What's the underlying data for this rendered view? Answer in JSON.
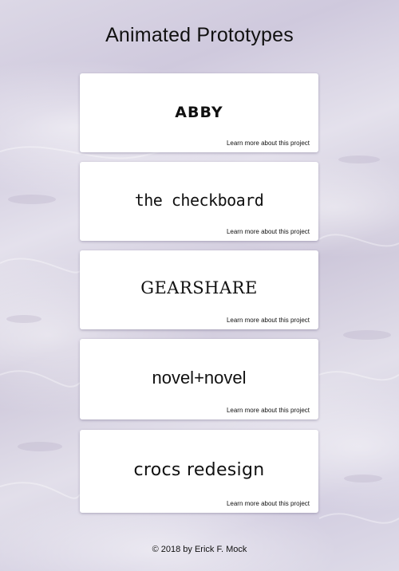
{
  "page": {
    "title": "Animated Prototypes",
    "footer": "© 2018 by Erick F. Mock"
  },
  "projects": [
    {
      "name": "ABBY",
      "link_label": "Learn more about this project"
    },
    {
      "name": "the checkboard",
      "link_label": "Learn more about this project"
    },
    {
      "name": "GEARSHARE",
      "link_label": "Learn more about this project"
    },
    {
      "name": "novel+novel",
      "link_label": "Learn more about this project"
    },
    {
      "name": "crocs redesign",
      "link_label": "Learn more about this project"
    }
  ],
  "colors": {
    "background_tint": "#d6d1e1",
    "card": "#ffffff",
    "text": "#111111"
  }
}
